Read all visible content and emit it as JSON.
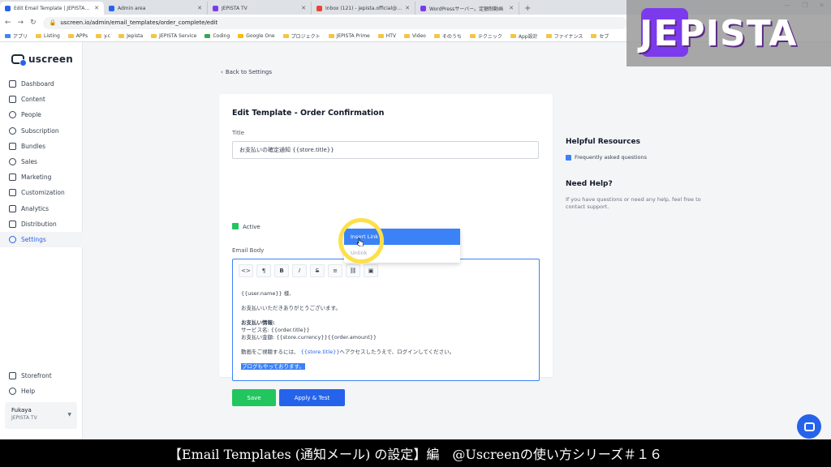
{
  "browser": {
    "tabs": [
      {
        "title": "Edit Email Template | JEPISTA TV",
        "fav": "#2563eb"
      },
      {
        "title": "Admin area",
        "fav": "#2563eb"
      },
      {
        "title": "JEPISTA TV",
        "fav": "#7c3aed"
      },
      {
        "title": "Inbox (121) - jepista.official@gm",
        "fav": "#ea4335"
      },
      {
        "title": "WordPressサーバー。定額制動画",
        "fav": "#7c3aed"
      }
    ],
    "url": "uscreen.io/admin/email_templates/order_complete/edit",
    "bookmarks": [
      "アプリ",
      "Listing",
      "APPs",
      "y.c",
      "Jepista",
      "JEPISTA Service",
      "Coding",
      "Google One",
      "プロジェクト",
      "JEPISTA Prime",
      "HTV",
      "Video",
      "そのうち",
      "テクニック",
      "App設計",
      "ファイナンス",
      "セブ"
    ]
  },
  "sidebar": {
    "logo": "uscreen",
    "items": [
      "Dashboard",
      "Content",
      "People",
      "Subscription",
      "Bundles",
      "Sales",
      "Marketing",
      "Customization",
      "Analytics",
      "Distribution",
      "Settings"
    ],
    "bottom": [
      "Storefront",
      "Help"
    ],
    "account": {
      "name": "Fukaya",
      "org": "JEPISTA TV"
    }
  },
  "back_link": "Back to Settings",
  "form": {
    "title": "Edit Template - Order Confirmation",
    "title_label": "Title",
    "title_value": "お支払いの確定通知 {{store.title}}",
    "active_label": "Active",
    "body_label": "Email Body",
    "toolbar": [
      "<>",
      "¶",
      "B",
      "I",
      "S",
      "≡"
    ],
    "body": {
      "line1": "{{user.name}} 様,",
      "line2": "お支払いいただきありがとうございます。",
      "line3": "お支払い情報:",
      "line4": "サービス名: {{order.title}}",
      "line5": "お支払い金額: {{store.currency}}{{order.amount}}",
      "line6a": "動画をご視聴するには、",
      "line6b": "{{store.title}}",
      "line6c": "へアクセスしたうえで、ログインしてください。",
      "line7": "ブログもやっております。"
    },
    "popup": {
      "insert": "Insert Link",
      "unlink": "Unlink"
    },
    "save": "Save",
    "apply": "Apply & Test"
  },
  "resources": {
    "title": "Helpful Resources",
    "link": "Frequently asked questions",
    "help_title": "Need Help?",
    "help_text": "If you have questions or need any help, feel free to contact support."
  },
  "overlay": {
    "logo": "JEPISTA"
  },
  "caption": "【Email Templates (通知メール) の設定】編　@Uscreenの使い方シリーズ＃１６"
}
